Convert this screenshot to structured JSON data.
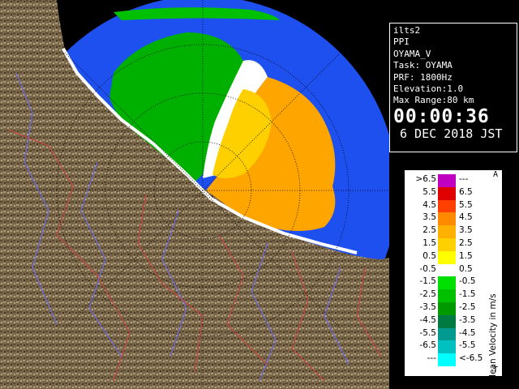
{
  "info": {
    "lines": [
      "ilts2",
      "PPI",
      "OYAMA_V",
      "Task: OYAMA",
      "PRF: 1800Hz",
      "Elevation:1.0",
      "Max Range:80 km"
    ],
    "time": "00:00:36",
    "date": "6 DEC 2018 JST"
  },
  "legend": {
    "title": "Mean Velocity in m/s",
    "top_mark": "A",
    "bottom_mark": "T",
    "rows": [
      {
        "lo": ">6.5",
        "hi": "---",
        "color": "#c000c0"
      },
      {
        "lo": "5.5",
        "hi": "6.5",
        "color": "#e00000"
      },
      {
        "lo": "4.5",
        "hi": "5.5",
        "color": "#ff4000"
      },
      {
        "lo": "3.5",
        "hi": "4.5",
        "color": "#ff8a00"
      },
      {
        "lo": "2.5",
        "hi": "3.5",
        "color": "#ffb000"
      },
      {
        "lo": "1.5",
        "hi": "2.5",
        "color": "#ffd000"
      },
      {
        "lo": "0.5",
        "hi": "1.5",
        "color": "#ffff00"
      },
      {
        "lo": "-0.5",
        "hi": "0.5",
        "color": "#ffffff"
      },
      {
        "lo": "-1.5",
        "hi": "-0.5",
        "color": "#00e000"
      },
      {
        "lo": "-2.5",
        "hi": "-1.5",
        "color": "#00c000"
      },
      {
        "lo": "-3.5",
        "hi": "-2.5",
        "color": "#009a00"
      },
      {
        "lo": "-4.5",
        "hi": "-3.5",
        "color": "#007a40"
      },
      {
        "lo": "-5.5",
        "hi": "-4.5",
        "color": "#009a90"
      },
      {
        "lo": "-6.5",
        "hi": "-5.5",
        "color": "#00c0c0"
      },
      {
        "lo": "---",
        "hi": "<-6.5",
        "color": "#00ffff"
      }
    ]
  },
  "colors": {
    "sea": "#1e50f0",
    "land": "#7d6a4a",
    "rivers": "#6a6aff",
    "borders": "#d04040"
  }
}
